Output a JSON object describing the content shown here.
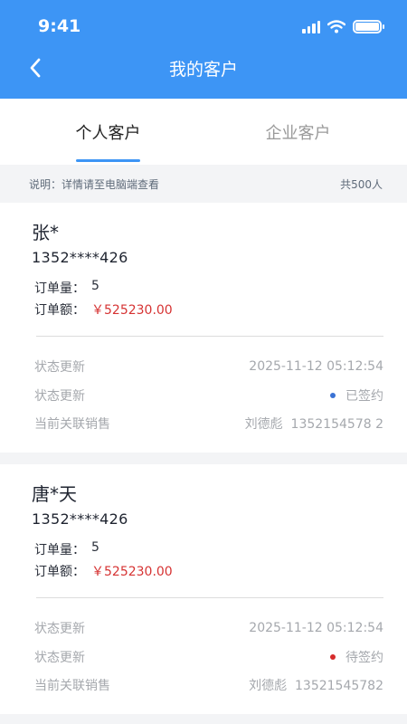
{
  "status_bar": {
    "time": "9:41"
  },
  "header": {
    "title": "我的客户"
  },
  "tabs": [
    {
      "label": "个人客户",
      "active": true
    },
    {
      "label": "企业客户",
      "active": false
    }
  ],
  "info": {
    "note": "说明：详情请至电脑端查看",
    "total": "共500人"
  },
  "colors": {
    "accent": "#3d95f5",
    "amount": "#d63333",
    "signed": "#3a72d4",
    "pending": "#d62b2b"
  },
  "customers": [
    {
      "name": "张*",
      "phone": "1352****426",
      "order_count_label": "订单量：",
      "order_count": "5",
      "order_amount_label": "订单额：",
      "order_amount": "￥525230.00",
      "status_update_label": "状态更新",
      "status_update_time": "2025-11-12 05:12:54",
      "status_label": "状态更新",
      "status": "已签约",
      "sales_label": "当前关联销售",
      "sales": "刘德彪  1352154578 2"
    },
    {
      "name": "唐*天",
      "phone": "1352****426",
      "order_count_label": "订单量：",
      "order_count": "5",
      "order_amount_label": "订单额：",
      "order_amount": "￥525230.00",
      "status_update_label": "状态更新",
      "status_update_time": "2025-11-12 05:12:54",
      "status_label": "状态更新",
      "status": "待签约",
      "sales_label": "当前关联销售",
      "sales": "刘德彪  13521545782"
    }
  ]
}
